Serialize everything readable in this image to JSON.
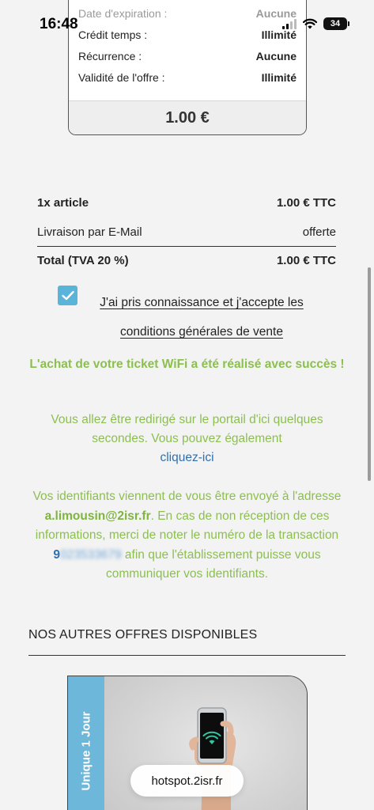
{
  "status_bar": {
    "time": "16:48",
    "battery": "34"
  },
  "offer_card": {
    "rows": [
      {
        "label": "Date d'expiration :",
        "value": "Aucune"
      },
      {
        "label": "Crédit temps :",
        "value": "Illimité"
      },
      {
        "label": "Récurrence :",
        "value": "Aucune"
      },
      {
        "label": "Validité de l'offre :",
        "value": "Illimité"
      }
    ],
    "price": "1.00 €"
  },
  "summary": {
    "article_label": "1x article",
    "article_value": "1.00 € TTC",
    "delivery_label": "Livraison par E-Mail",
    "delivery_value": "offerte",
    "total_label": "Total (TVA 20 %)",
    "total_value": "1.00 € TTC"
  },
  "terms": {
    "text": "J'ai pris connaissance et j'accepte les conditions générales de vente",
    "checked": true
  },
  "success_message": "L'achat de votre ticket WiFi a été réalisé avec succès !",
  "redirect": {
    "text": "Vous allez être redirigé sur le portail d'ici quelques secondes. Vous pouvez également",
    "link": "cliquez-ici"
  },
  "credentials": {
    "part1": "Vos identifiants viennent de vous être envoyé à l'adresse",
    "email": "a.limousin@2isr.fr",
    "part2": ". En cas de non réception de ces informations, merci de noter le numéro de la transaction",
    "transaction_visible": "9",
    "transaction_blurred": "023533679",
    "part3": "afin que l'établissement puisse vous communiquer vos identifiants."
  },
  "other_offers": {
    "title": "NOS AUTRES OFFRES DISPONIBLES",
    "card_label": "Unique 1 Jour"
  },
  "browser": {
    "url": "hotspot.2isr.fr"
  },
  "colors": {
    "success_green": "#8cbf4f",
    "link_blue": "#2f6fae",
    "accent_blue": "#5ab3d9"
  }
}
